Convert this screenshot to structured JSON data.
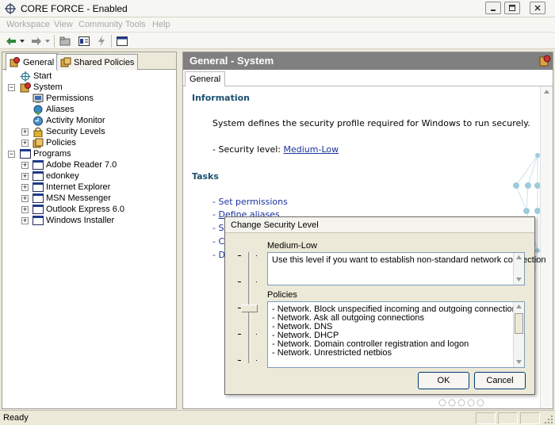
{
  "window": {
    "title": "CORE FORCE - Enabled",
    "accent": "#1f3a8a"
  },
  "menu": {
    "items": [
      "Workspace",
      "View",
      "Community",
      "Tools",
      "Help"
    ]
  },
  "toolbar": {
    "icons": [
      "back-arrow-icon",
      "dropdown-icon",
      "forward-arrow-icon",
      "dropdown-icon",
      "folder-icon",
      "properties-icon",
      "wizard-icon",
      "window-icon"
    ]
  },
  "left_panel": {
    "tabs": [
      {
        "label": "General",
        "icon": "general-icon",
        "active": true
      },
      {
        "label": "Shared Policies",
        "icon": "shared-policies-icon",
        "active": false
      }
    ],
    "tree": {
      "start": "Start",
      "system": "System",
      "system_children": [
        "Permissions",
        "Aliases",
        "Activity Monitor",
        "Security Levels",
        "Policies"
      ],
      "programs": "Programs",
      "program_children": [
        "Adobe Reader 7.0",
        "edonkey",
        "Internet Explorer",
        "MSN Messenger",
        "Outlook Express 6.0",
        "Windows Installer"
      ]
    }
  },
  "right_panel": {
    "header": "General - System",
    "tab": "General",
    "information_title": "Information",
    "description": "System defines the security profile required for Windows to run securely.",
    "security_level_label": "- Security level: ",
    "security_level_value": "Medium-Low",
    "tasks_title": "Tasks",
    "tasks": [
      {
        "prefix": "- ",
        "label": "Set permissions"
      },
      {
        "prefix": "- ",
        "label": "Define aliases"
      },
      {
        "prefix": "- ",
        "label": "S"
      },
      {
        "prefix": "- ",
        "label": "C"
      },
      {
        "prefix": "- ",
        "label": "D"
      }
    ]
  },
  "dialog": {
    "title": "Change Security Level",
    "level_name": "Medium-Low",
    "level_description": "Use this level if you want to establish non-standard network connection",
    "policies_label": "Policies",
    "policies": [
      "- Network. Block unspecified incoming and outgoing connections",
      "- Network. Ask all outgoing connections",
      "- Network. DNS",
      "- Network. DHCP",
      "- Network. Domain controller registration and logon",
      "- Network. Unrestricted netbios"
    ],
    "slider_level": 3,
    "slider_levels_total": 5,
    "ok_label": "OK",
    "cancel_label": "Cancel"
  },
  "status": {
    "text": "Ready"
  }
}
